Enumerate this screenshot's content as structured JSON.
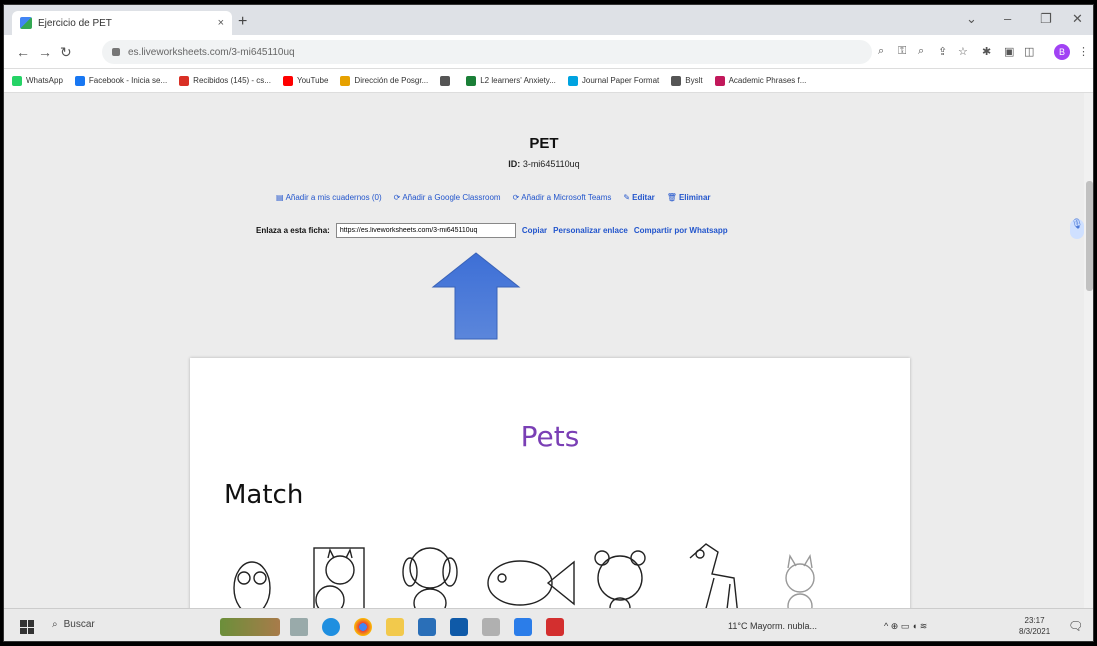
{
  "browser": {
    "tab_title": "Ejercicio de PET",
    "tab_close": "×",
    "new_tab": "+",
    "address": "es.liveworksheets.com/3-mi645110uq",
    "profile_initial": "B",
    "bookmarks": [
      {
        "label": "WhatsApp",
        "color": "#25d366"
      },
      {
        "label": "Facebook - Inicia se...",
        "color": "#1877f2"
      },
      {
        "label": "Recibidos (145) - cs...",
        "color": "#d93025"
      },
      {
        "label": "YouTube",
        "color": "#ff0000"
      },
      {
        "label": "Dirección de Posgr...",
        "color": "#e6a100"
      },
      {
        "label": "",
        "color": "#555555"
      },
      {
        "label": "L2 learners' Anxiety...",
        "color": "#1a7f37"
      },
      {
        "label": "Journal Paper Format",
        "color": "#00a3e0"
      },
      {
        "label": "Byslt",
        "color": "#555555"
      },
      {
        "label": "Academic Phrases f...",
        "color": "#c2185b"
      }
    ]
  },
  "page": {
    "title": "PET",
    "id_label": "ID:",
    "id_value": "3-mi645110uq",
    "actions": [
      {
        "icon": "book-plus-icon",
        "label": "Añadir a mis cuadernos (0)"
      },
      {
        "icon": "classroom-icon",
        "label": "Añadir a Google Classroom"
      },
      {
        "icon": "teams-icon",
        "label": "Añadir a Microsoft Teams"
      },
      {
        "icon": "edit-icon",
        "label": "Editar"
      },
      {
        "icon": "trash-icon",
        "label": "Eliminar"
      }
    ],
    "link_label": "Enlaza a esta ficha:",
    "link_value": "https://es.liveworksheets.com/3-mi645110uq",
    "copy_label": "Copiar",
    "customize_label": "Personalizar enlace",
    "whatsapp_label": "Compartir por Whatsapp",
    "accent_color": "#4a78d8"
  },
  "worksheet": {
    "title": "Pets",
    "subtitle": "Match",
    "title_color": "#7a3fb5"
  },
  "taskbar": {
    "search_label": "Buscar",
    "weather": "11°C  Mayorm. nubla...",
    "time": "23:17",
    "date": "8/3/2021"
  }
}
